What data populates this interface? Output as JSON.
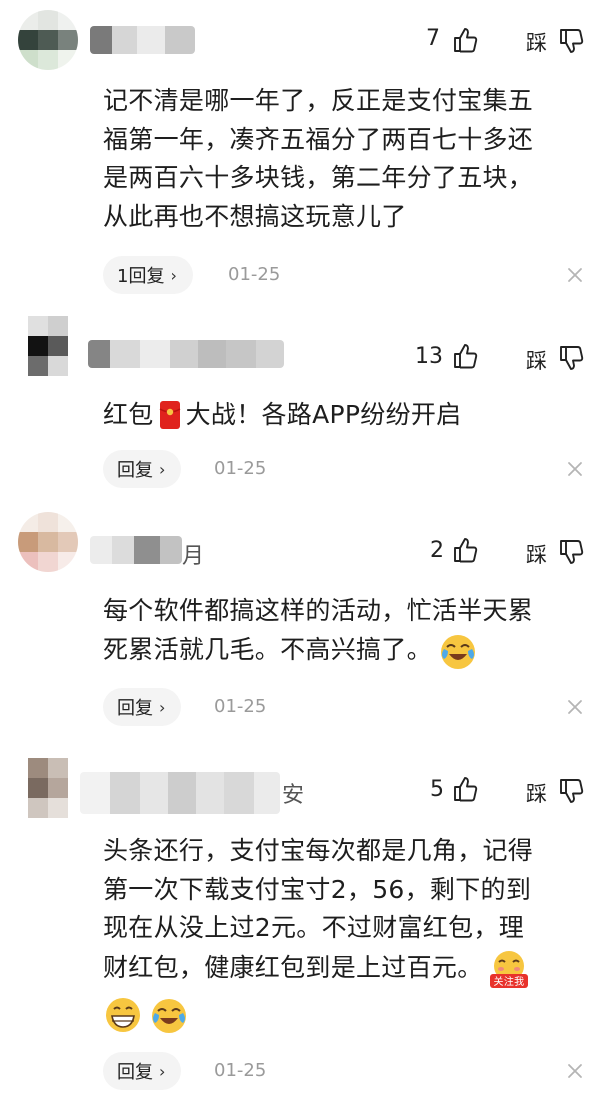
{
  "comments": [
    {
      "likes": "7",
      "dislike_label": "踩",
      "lines": [
        "记不清是哪一年了，反正是支付宝集五",
        "福第一年，凑齐五福分了两百七十多还",
        "是两百六十多块钱，第二年分了五块，",
        "从此再也不想搞这玩意儿了"
      ],
      "reply_label": "1回复",
      "date": "01-25",
      "name_fragment": ""
    },
    {
      "likes": "13",
      "dislike_label": "踩",
      "text_before_emoji": "红包",
      "text_after_emoji": "大战！各路APP纷纷开启",
      "reply_label": "回复",
      "date": "01-25",
      "name_fragment": ""
    },
    {
      "likes": "2",
      "dislike_label": "踩",
      "lines": [
        "每个软件都搞这样的活动，忙活半天累",
        "死累活就几毛。不高兴搞了。"
      ],
      "reply_label": "回复",
      "date": "01-25",
      "name_fragment": "月"
    },
    {
      "likes": "5",
      "dislike_label": "踩",
      "lines": [
        "头条还行，支付宝每次都是几角，记得",
        "第一次下载支付宝寸2，56，剩下的到",
        "现在从没上过2元。不过财富红包，理",
        "财红包，健康红包到是上过百元。"
      ],
      "reply_label": "回复",
      "date": "01-25",
      "name_fragment": "安",
      "sticker_text": "关注我"
    }
  ],
  "icons": {
    "like": "thumbs-up-icon",
    "dislike": "thumbs-down-icon",
    "close": "close-icon",
    "chevron": "chevron-right-icon",
    "red_envelope": "red-envelope-emoji",
    "crying": "crying-laughing-emoji",
    "grin": "grinning-emoji"
  },
  "chevron_glyph": "›"
}
